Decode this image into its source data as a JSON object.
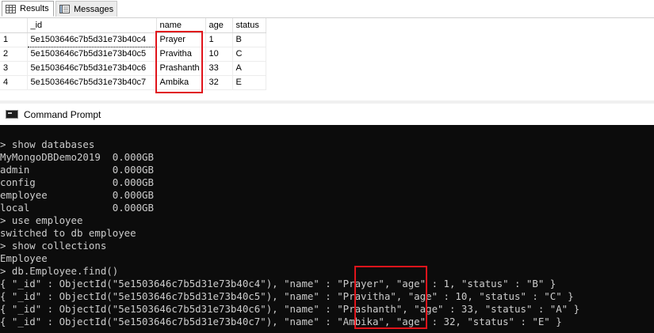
{
  "tabs": [
    {
      "label": "Results",
      "icon": "grid-icon"
    },
    {
      "label": "Messages",
      "icon": "messages-icon"
    }
  ],
  "grid": {
    "columns": [
      "",
      "_id",
      "name",
      "age",
      "status"
    ],
    "rows": [
      {
        "num": "1",
        "id": "5e1503646c7b5d31e73b40c4",
        "name": "Prayer",
        "age": "1",
        "status": "B"
      },
      {
        "num": "2",
        "id": "5e1503646c7b5d31e73b40c5",
        "name": "Pravitha",
        "age": "10",
        "status": "C"
      },
      {
        "num": "3",
        "id": "5e1503646c7b5d31e73b40c6",
        "name": "Prashanth",
        "age": "33",
        "status": "A"
      },
      {
        "num": "4",
        "id": "5e1503646c7b5d31e73b40c7",
        "name": "Ambika",
        "age": "32",
        "status": "E"
      }
    ]
  },
  "command_prompt": {
    "title": "Command Prompt",
    "lines": [
      "> show databases",
      "MyMongoDBDemo2019  0.000GB",
      "admin              0.000GB",
      "config             0.000GB",
      "employee           0.000GB",
      "local              0.000GB",
      "> use employee",
      "switched to db employee",
      "> show collections",
      "Employee",
      "> db.Employee.find()",
      "{ \"_id\" : ObjectId(\"5e1503646c7b5d31e73b40c4\"), \"name\" : \"Prayer\", \"age\" : 1, \"status\" : \"B\" }",
      "{ \"_id\" : ObjectId(\"5e1503646c7b5d31e73b40c5\"), \"name\" : \"Pravitha\", \"age\" : 10, \"status\" : \"C\" }",
      "{ \"_id\" : ObjectId(\"5e1503646c7b5d31e73b40c6\"), \"name\" : \"Prashanth\", \"age\" : 33, \"status\" : \"A\" }",
      "{ \"_id\" : ObjectId(\"5e1503646c7b5d31e73b40c7\"), \"name\" : \"Ambika\", \"age\" : 32, \"status\" : \"E\" }"
    ]
  },
  "colors": {
    "highlight": "#e0141b",
    "console_bg": "#0c0c0c",
    "console_fg": "#cccccc"
  }
}
